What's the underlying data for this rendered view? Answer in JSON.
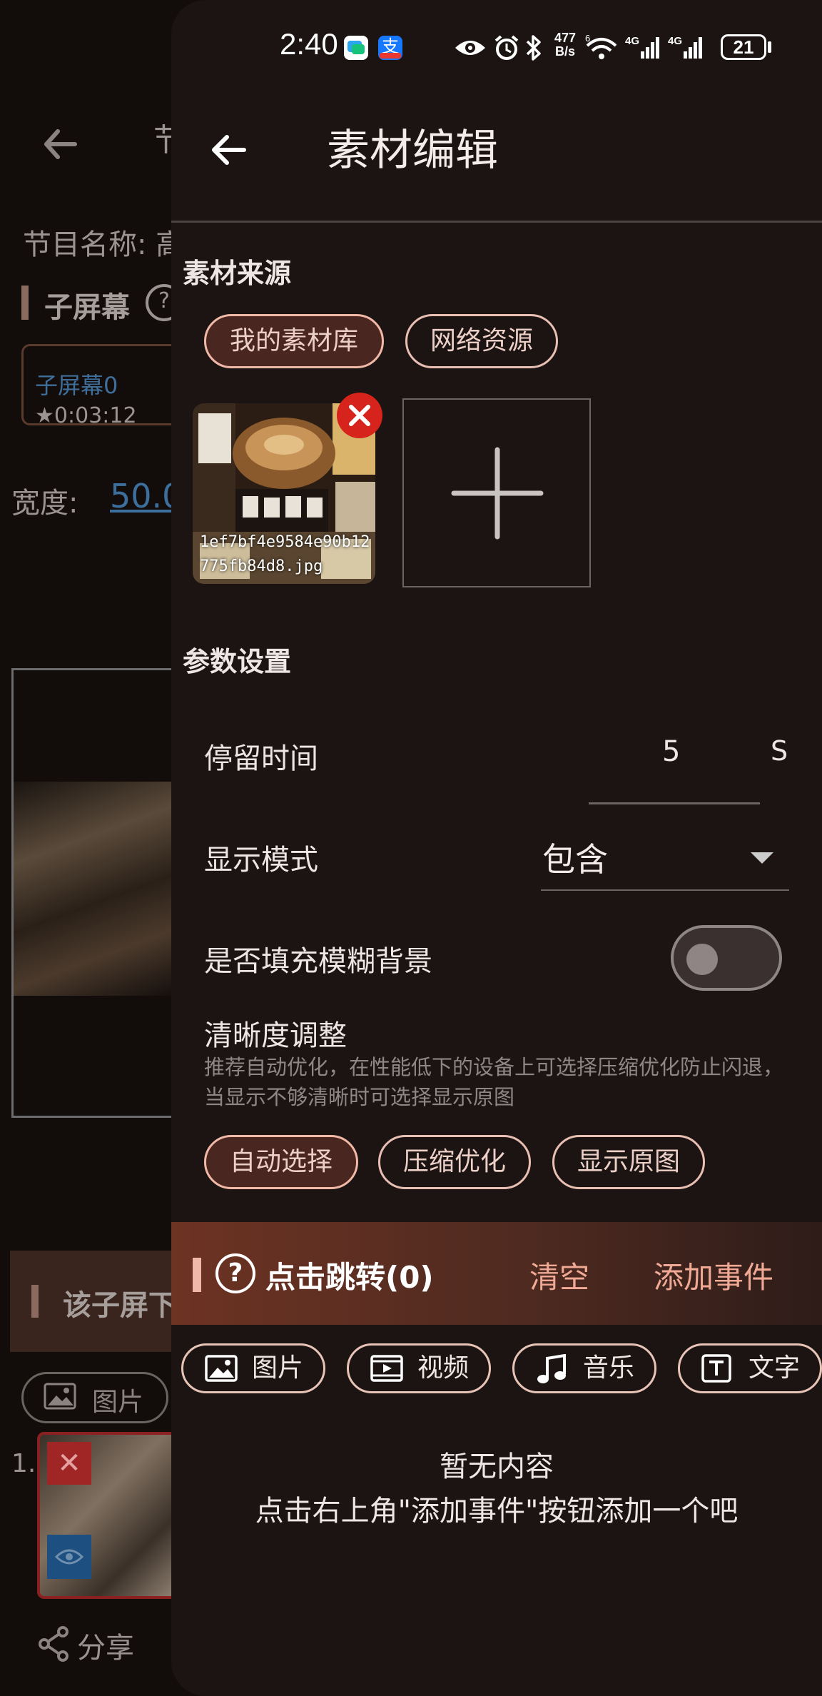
{
  "background": {
    "title_partial": "节",
    "program_name_label": "节目名称: 高",
    "subscreen_label": "子屏幕",
    "card_name": "子屏幕0",
    "card_duration": "★0:03:12",
    "width_label": "宽度:",
    "width_value": "50.0",
    "subscreen_section_partial": "该子屏下",
    "image_chip": "图片",
    "item_index": "1.",
    "share_label": "分享"
  },
  "status_bar": {
    "time": "2:40",
    "net_speed_value": "477",
    "net_speed_unit": "B/s",
    "wifi_badge": "6",
    "signal1": "4G",
    "signal2": "4G",
    "battery": "21"
  },
  "header": {
    "title": "素材编辑"
  },
  "source": {
    "section_title": "素材来源",
    "tabs": [
      {
        "label": "我的素材库",
        "selected": true
      },
      {
        "label": "网络资源",
        "selected": false
      }
    ],
    "thumbnail_filename": "1ef7bf4e9584e90b12775fb84d8.jpg"
  },
  "params": {
    "section_title": "参数设置",
    "stay_label": "停留时间",
    "stay_value": "5",
    "stay_unit": "S",
    "mode_label": "显示模式",
    "mode_value": "包含",
    "blur_label": "是否填充模糊背景",
    "blur_enabled": false,
    "clarity_label": "清晰度调整",
    "clarity_desc": "推荐自动优化，在性能低下的设备上可选择压缩优化防止闪退，当显示不够清晰时可选择显示原图",
    "clarity_options": [
      {
        "label": "自动选择",
        "selected": true
      },
      {
        "label": "压缩优化",
        "selected": false
      },
      {
        "label": "显示原图",
        "selected": false
      }
    ]
  },
  "events": {
    "title": "点击跳转(0)",
    "clear_label": "清空",
    "add_label": "添加事件",
    "types": [
      {
        "label": "图片",
        "icon": "image-icon"
      },
      {
        "label": "视频",
        "icon": "video-icon"
      },
      {
        "label": "音乐",
        "icon": "music-icon"
      },
      {
        "label": "文字",
        "icon": "text-icon"
      }
    ],
    "empty_title": "暂无内容",
    "empty_hint": "点击右上角\"添加事件\"按钮添加一个吧"
  },
  "colors": {
    "accent": "#f0a995",
    "panel_bg": "#1b1413",
    "delete_red": "#d6241c"
  }
}
